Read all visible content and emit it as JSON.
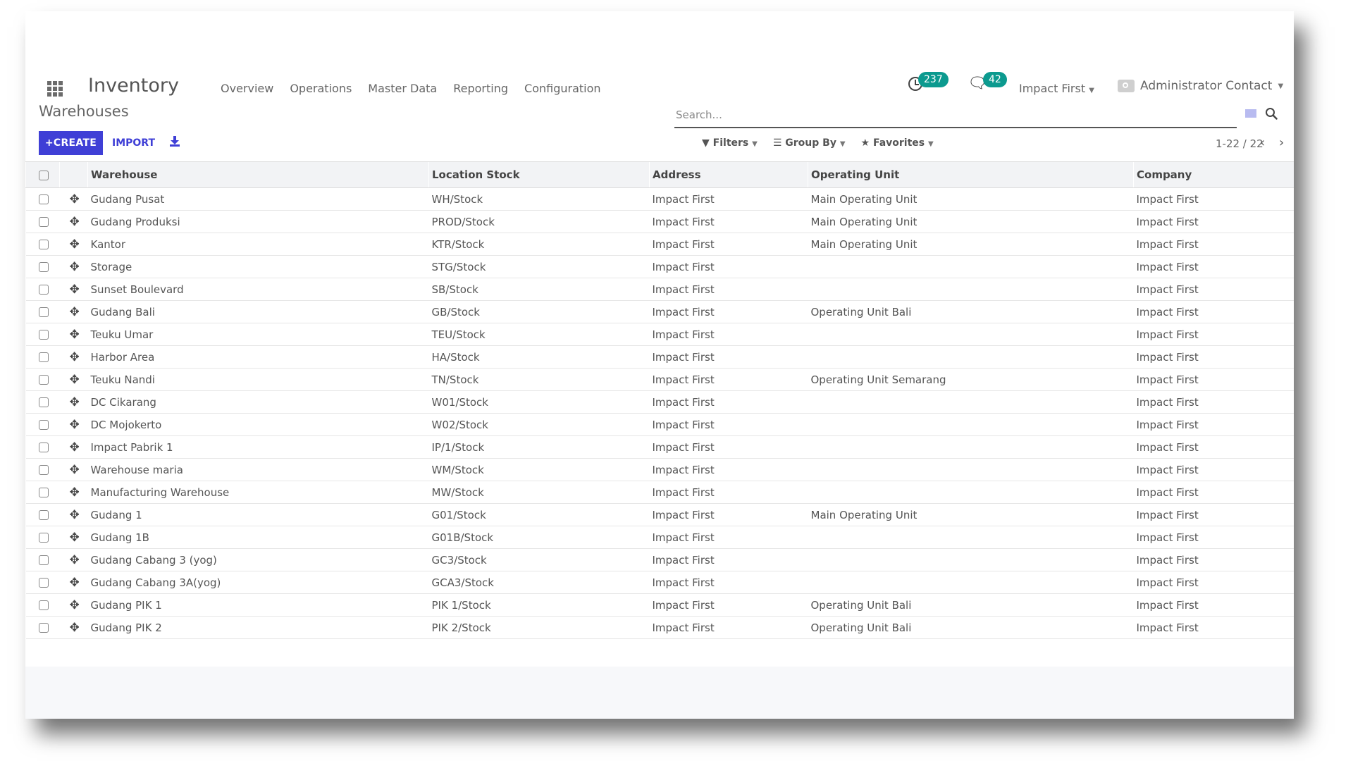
{
  "navbar": {
    "app_title": "Inventory",
    "menu": [
      "Overview",
      "Operations",
      "Master Data",
      "Reporting",
      "Configuration"
    ],
    "activity_count": "237",
    "message_count": "42",
    "company": "Impact First",
    "user": "Administrator Contact"
  },
  "control_panel": {
    "breadcrumb": "Warehouses",
    "search_placeholder": "Search...",
    "create_label": "CREATE",
    "import_label": "IMPORT",
    "filters_label": "Filters",
    "group_by_label": "Group By",
    "favorites_label": "Favorites",
    "pager": "1-22 / 22"
  },
  "table": {
    "columns": [
      "Warehouse",
      "Location Stock",
      "Address",
      "Operating Unit",
      "Company"
    ],
    "rows": [
      [
        "Gudang Pusat",
        "WH/Stock",
        "Impact First",
        "Main Operating Unit",
        "Impact First"
      ],
      [
        "Gudang Produksi",
        "PROD/Stock",
        "Impact First",
        "Main Operating Unit",
        "Impact First"
      ],
      [
        "Kantor",
        "KTR/Stock",
        "Impact First",
        "Main Operating Unit",
        "Impact First"
      ],
      [
        "Storage",
        "STG/Stock",
        "Impact First",
        "",
        "Impact First"
      ],
      [
        "Sunset Boulevard",
        "SB/Stock",
        "Impact First",
        "",
        "Impact First"
      ],
      [
        "Gudang Bali",
        "GB/Stock",
        "Impact First",
        "Operating Unit Bali",
        "Impact First"
      ],
      [
        "Teuku Umar",
        "TEU/Stock",
        "Impact First",
        "",
        "Impact First"
      ],
      [
        "Harbor Area",
        "HA/Stock",
        "Impact First",
        "",
        "Impact First"
      ],
      [
        "Teuku Nandi",
        "TN/Stock",
        "Impact First",
        "Operating Unit Semarang",
        "Impact First"
      ],
      [
        "DC Cikarang",
        "W01/Stock",
        "Impact First",
        "",
        "Impact First"
      ],
      [
        "DC Mojokerto",
        "W02/Stock",
        "Impact First",
        "",
        "Impact First"
      ],
      [
        "Impact Pabrik 1",
        "IP/1/Stock",
        "Impact First",
        "",
        "Impact First"
      ],
      [
        "Warehouse maria",
        "WM/Stock",
        "Impact First",
        "",
        "Impact First"
      ],
      [
        "Manufacturing Warehouse",
        "MW/Stock",
        "Impact First",
        "",
        "Impact First"
      ],
      [
        "Gudang 1",
        "G01/Stock",
        "Impact First",
        "Main Operating Unit",
        "Impact First"
      ],
      [
        "Gudang 1B",
        "G01B/Stock",
        "Impact First",
        "",
        "Impact First"
      ],
      [
        "Gudang Cabang 3 (yog)",
        "GC3/Stock",
        "Impact First",
        "",
        "Impact First"
      ],
      [
        "Gudang Cabang 3A(yog)",
        "GCA3/Stock",
        "Impact First",
        "",
        "Impact First"
      ],
      [
        "Gudang PIK 1",
        "PIK 1/Stock",
        "Impact First",
        "Operating Unit Bali",
        "Impact First"
      ],
      [
        "Gudang PIK 2",
        "PIK 2/Stock",
        "Impact First",
        "Operating Unit Bali",
        "Impact First"
      ]
    ]
  },
  "colors": {
    "primary": "#3f3fd6",
    "badge": "#0c9a8f"
  }
}
